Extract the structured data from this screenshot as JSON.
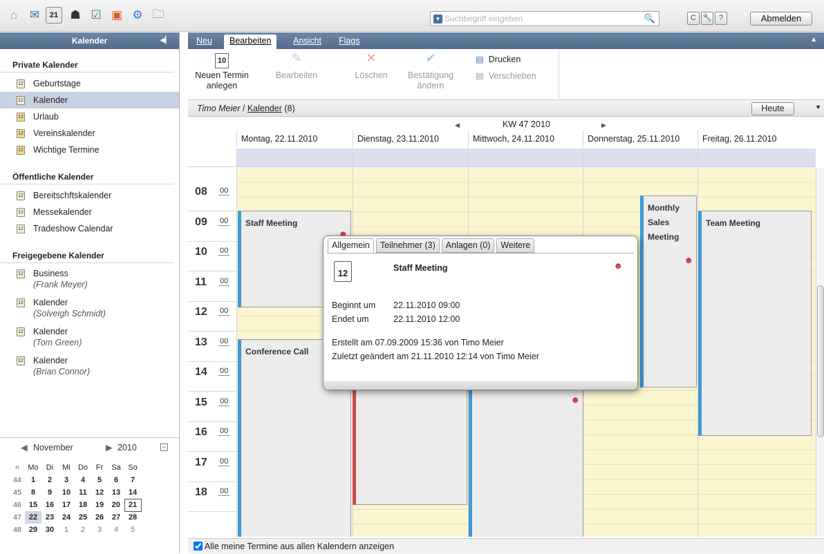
{
  "toolbar": {
    "icons": [
      "home-icon",
      "mail-icon",
      "calendar-icon",
      "contacts-icon",
      "tasks-icon",
      "portfolio-icon",
      "settings-icon",
      "folder-icon"
    ],
    "search_placeholder": "Suchbegriff eingeben",
    "refresh": "C",
    "help": "?",
    "logout": "Abmelden"
  },
  "sidebar": {
    "title": "Kalender",
    "private_title": "Private Kalender",
    "private": [
      "Geburtstage",
      "Kalender",
      "Urlaub",
      "Vereinskalender",
      "Wichtige Termine"
    ],
    "public_title": "Öffentliche Kalender",
    "public": [
      "Bereitschftskalender",
      "Messekalender",
      "Tradeshow Calendar"
    ],
    "shared_title": "Freigegebene Kalender",
    "shared": [
      {
        "name": "Business",
        "owner": "(Frank Meyer)"
      },
      {
        "name": "Kalender",
        "owner": "(Solveigh Schmidt)"
      },
      {
        "name": "Kalender",
        "owner": "(Tom Green)"
      },
      {
        "name": "Kalender",
        "owner": "(Brian Connor)"
      }
    ]
  },
  "minical": {
    "month": "November",
    "year": "2010",
    "weekdays": [
      "Mo",
      "Di",
      "Mi",
      "Do",
      "Fr",
      "Sa",
      "So"
    ],
    "weeks": [
      {
        "wk": "44",
        "days": [
          "1",
          "2",
          "3",
          "4",
          "5",
          "6",
          "7"
        ]
      },
      {
        "wk": "45",
        "days": [
          "8",
          "9",
          "10",
          "11",
          "12",
          "13",
          "14"
        ]
      },
      {
        "wk": "46",
        "days": [
          "15",
          "16",
          "17",
          "18",
          "19",
          "20",
          "21"
        ]
      },
      {
        "wk": "47",
        "days": [
          "22",
          "23",
          "24",
          "25",
          "26",
          "27",
          "28"
        ]
      },
      {
        "wk": "48",
        "days": [
          "29",
          "30",
          "1",
          "2",
          "3",
          "4",
          "5"
        ]
      }
    ]
  },
  "menu": {
    "neu": "Neu",
    "bearbeiten": "Bearbeiten",
    "ansicht": "Ansicht",
    "flags": "Flags"
  },
  "ribbon": {
    "new_line1": "Neuen Termin",
    "new_line2": "anlegen",
    "new_icon_num": "10",
    "edit": "Bearbeiten",
    "delete": "Löschen",
    "confirm_line1": "Bestätigung",
    "confirm_line2": "ändern",
    "print": "Drucken",
    "move": "Verschieben"
  },
  "path": {
    "user": "Timo Meier",
    "sep": " / ",
    "calendar": "Kalender",
    "count": " (8)",
    "today": "Heute"
  },
  "week": {
    "label": "KW 47 2010",
    "days": [
      "Montag, 22.11.2010",
      "Dienstag, 23.11.2010",
      "Mittwoch, 24.11.2010",
      "Donnerstag, 25.11.2010",
      "Freitag, 26.11.2010"
    ]
  },
  "hours": [
    {
      "h": "08",
      "m": "00"
    },
    {
      "h": "09",
      "m": "00"
    },
    {
      "h": "10",
      "m": "00"
    },
    {
      "h": "11",
      "m": "00"
    },
    {
      "h": "12",
      "m": "00"
    },
    {
      "h": "13",
      "m": "00"
    },
    {
      "h": "14",
      "m": "00"
    },
    {
      "h": "15",
      "m": "00"
    },
    {
      "h": "16",
      "m": "00"
    },
    {
      "h": "17",
      "m": "00"
    },
    {
      "h": "18",
      "m": "00"
    }
  ],
  "appointments": {
    "staff": "Staff Meeting",
    "conference": "Conference Call",
    "monthly1": "Monthly",
    "monthly2": "Sales",
    "monthly3": "Meeting",
    "team": "Team Meeting"
  },
  "popup": {
    "tabs": [
      "Allgemein",
      "Teilnehmer (3)",
      "Anlagen (0)",
      "Weitere"
    ],
    "icon_num": "12",
    "title": "Staff Meeting",
    "start_label": "Beginnt um",
    "start": "22.11.2010 09:00",
    "end_label": "Endet um",
    "end": "22.11.2010 12:00",
    "created": "Erstellt am 07.09.2009 15:36 von Timo Meier",
    "modified": "Zuletzt geändert am 21.11.2010 12:14 von Timo Meier"
  },
  "footer": {
    "show_all": "Alle meine Termine aus allen Kalendern anzeigen"
  }
}
